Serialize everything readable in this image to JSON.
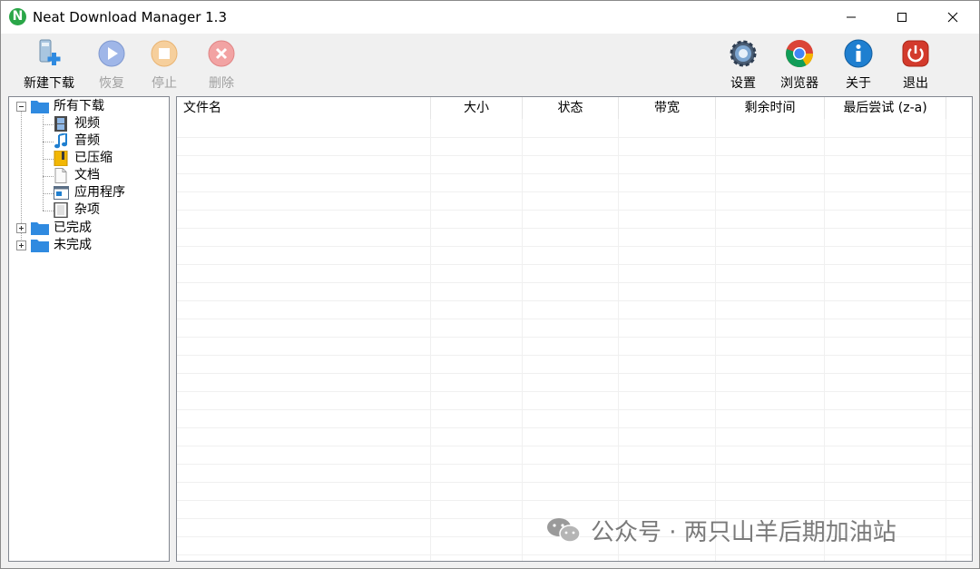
{
  "window": {
    "title": "Neat Download Manager 1.3",
    "app_icon_letter": "N"
  },
  "toolbar": {
    "new_download": "新建下载",
    "resume": "恢复",
    "stop": "停止",
    "delete": "删除",
    "settings": "设置",
    "browser": "浏览器",
    "about": "关于",
    "exit": "退出"
  },
  "tree": {
    "all_downloads": "所有下载",
    "video": "视频",
    "audio": "音频",
    "compressed": "已压缩",
    "documents": "文档",
    "programs": "应用程序",
    "misc": "杂项",
    "completed": "已完成",
    "incomplete": "未完成"
  },
  "list": {
    "columns": [
      "文件名",
      "大小",
      "状态",
      "带宽",
      "剩余时间",
      "最后尝试 (z-a)"
    ]
  },
  "watermark": "公众号 · 两只山羊后期加油站",
  "colors": {
    "folder": "#2f8ae0",
    "accent_green": "#2aa648"
  }
}
